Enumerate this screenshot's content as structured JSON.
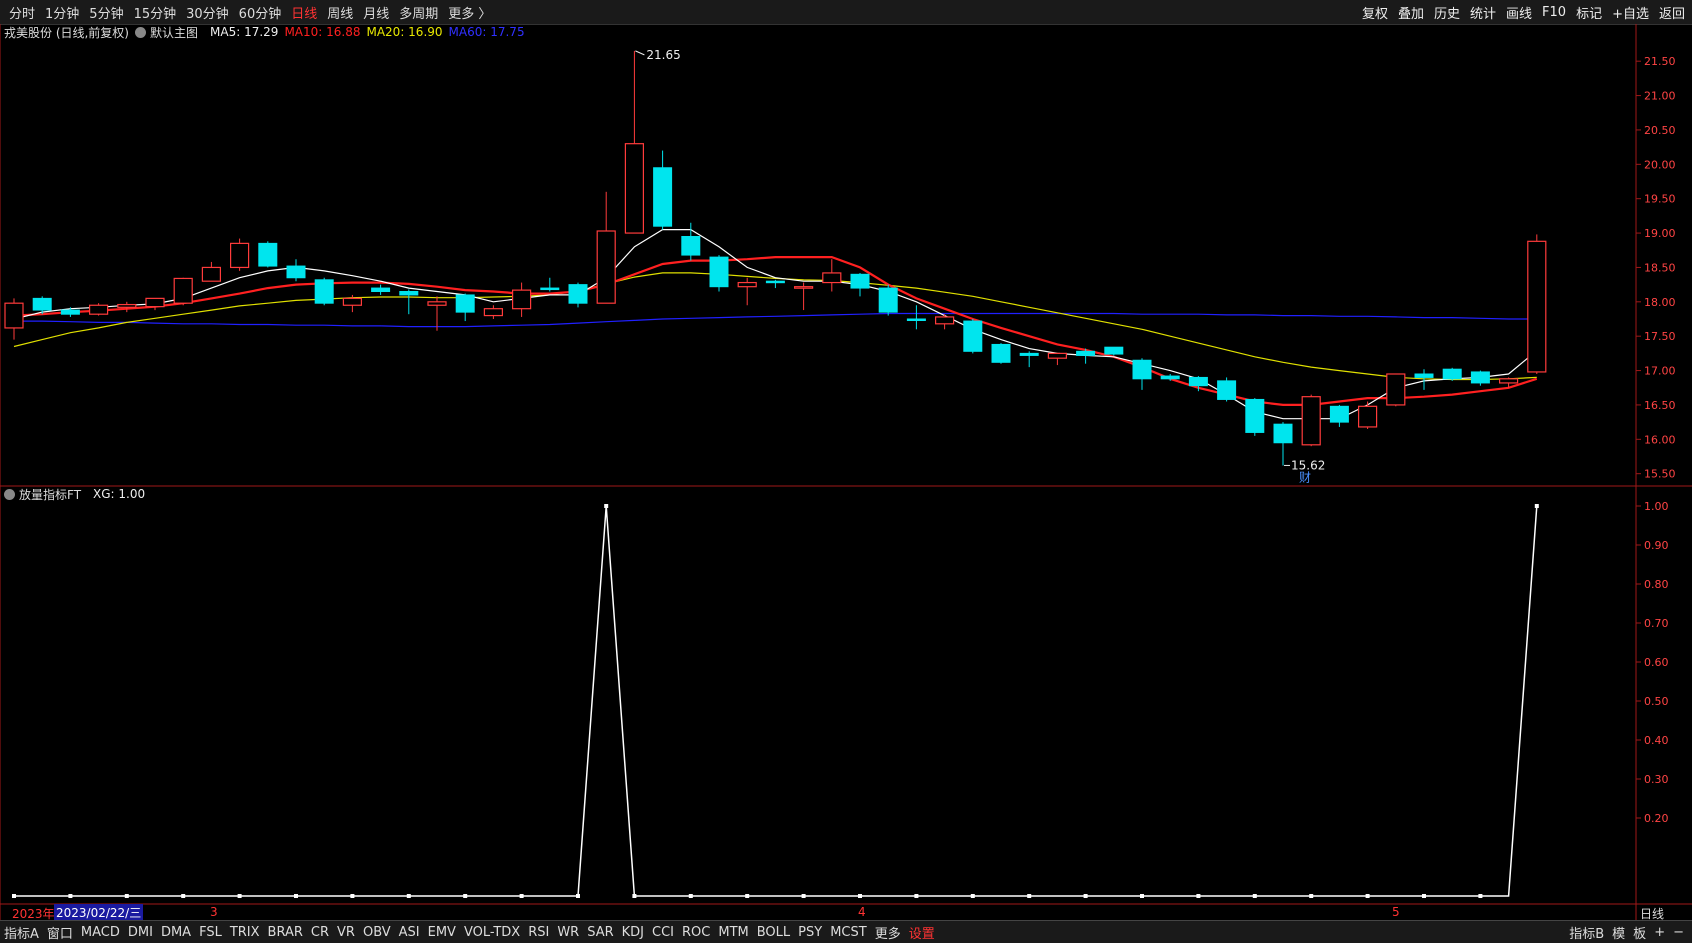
{
  "toolbar": {
    "periods": [
      "分时",
      "1分钟",
      "5分钟",
      "15分钟",
      "30分钟",
      "60分钟",
      "日线",
      "周线",
      "月线",
      "多周期",
      "更多 〉"
    ],
    "active_period": "日线",
    "right_buttons": [
      "复权",
      "叠加",
      "历史",
      "统计",
      "画线",
      "F10",
      "标记",
      "+自选",
      "返回"
    ]
  },
  "main_legend": {
    "stock": "戎美股份 (日线,前复权)",
    "template": "默认主图",
    "ma5": "MA5: 17.29",
    "ma10": "MA10: 16.88",
    "ma20": "MA20: 16.90",
    "ma60": "MA60: 17.75",
    "colors": {
      "ma5": "#ffffff",
      "ma10": "#ff2020",
      "ma20": "#e0e000",
      "ma60": "#2020ff",
      "up": "#ff3b3b",
      "down": "#00e5ee"
    }
  },
  "sub_legend": {
    "name": "放量指标FT",
    "value": "XG: 1.00"
  },
  "annotations": {
    "high": "21.65",
    "low": "15.62",
    "finance_mark": "财"
  },
  "price_axis": {
    "ticks": [
      "21.50",
      "21.00",
      "20.50",
      "20.00",
      "19.50",
      "19.00",
      "18.50",
      "18.00",
      "17.50",
      "17.00",
      "16.50",
      "16.00",
      "15.50"
    ],
    "min": 15.35,
    "max": 21.75
  },
  "indicator_axis": {
    "ticks": [
      "1.00",
      "0.90",
      "0.80",
      "0.70",
      "0.60",
      "0.50",
      "0.40",
      "0.30",
      "0.20"
    ]
  },
  "time_axis": {
    "year": "2023年",
    "cursor_date": "2023/02/22/三",
    "month_marks": [
      "3",
      "4",
      "5"
    ],
    "period": "日线"
  },
  "chart_data": {
    "type": "candlestick",
    "candles": [
      {
        "o": 17.62,
        "h": 18.05,
        "l": 17.45,
        "c": 17.98
      },
      {
        "o": 18.05,
        "h": 18.08,
        "l": 17.82,
        "c": 17.88
      },
      {
        "o": 17.88,
        "h": 17.92,
        "l": 17.78,
        "c": 17.82
      },
      {
        "o": 17.82,
        "h": 17.98,
        "l": 17.8,
        "c": 17.95
      },
      {
        "o": 17.92,
        "h": 18.0,
        "l": 17.85,
        "c": 17.96
      },
      {
        "o": 17.93,
        "h": 18.05,
        "l": 17.88,
        "c": 18.05
      },
      {
        "o": 17.98,
        "h": 18.35,
        "l": 17.95,
        "c": 18.34
      },
      {
        "o": 18.3,
        "h": 18.58,
        "l": 18.3,
        "c": 18.5
      },
      {
        "o": 18.5,
        "h": 18.92,
        "l": 18.45,
        "c": 18.85
      },
      {
        "o": 18.85,
        "h": 18.88,
        "l": 18.5,
        "c": 18.52
      },
      {
        "o": 18.52,
        "h": 18.62,
        "l": 18.3,
        "c": 18.35
      },
      {
        "o": 18.32,
        "h": 18.35,
        "l": 17.95,
        "c": 17.98
      },
      {
        "o": 17.95,
        "h": 18.1,
        "l": 17.85,
        "c": 18.05
      },
      {
        "o": 18.2,
        "h": 18.25,
        "l": 18.1,
        "c": 18.15
      },
      {
        "o": 18.15,
        "h": 18.18,
        "l": 17.82,
        "c": 18.1
      },
      {
        "o": 17.95,
        "h": 18.08,
        "l": 17.58,
        "c": 18.0
      },
      {
        "o": 18.1,
        "h": 18.12,
        "l": 17.72,
        "c": 17.85
      },
      {
        "o": 17.8,
        "h": 17.95,
        "l": 17.75,
        "c": 17.9
      },
      {
        "o": 17.9,
        "h": 18.28,
        "l": 17.78,
        "c": 18.17
      },
      {
        "o": 18.2,
        "h": 18.35,
        "l": 18.15,
        "c": 18.18
      },
      {
        "o": 18.25,
        "h": 18.28,
        "l": 17.92,
        "c": 17.98
      },
      {
        "o": 17.98,
        "h": 19.6,
        "l": 17.98,
        "c": 19.03
      },
      {
        "o": 19.0,
        "h": 21.65,
        "l": 19.0,
        "c": 20.3
      },
      {
        "o": 19.95,
        "h": 20.2,
        "l": 19.05,
        "c": 19.1
      },
      {
        "o": 18.95,
        "h": 19.15,
        "l": 18.6,
        "c": 18.68
      },
      {
        "o": 18.65,
        "h": 18.68,
        "l": 18.15,
        "c": 18.22
      },
      {
        "o": 18.22,
        "h": 18.35,
        "l": 17.95,
        "c": 18.28
      },
      {
        "o": 18.3,
        "h": 18.32,
        "l": 18.2,
        "c": 18.28
      },
      {
        "o": 18.2,
        "h": 18.28,
        "l": 17.88,
        "c": 18.22
      },
      {
        "o": 18.28,
        "h": 18.62,
        "l": 18.15,
        "c": 18.42
      },
      {
        "o": 18.4,
        "h": 18.42,
        "l": 18.08,
        "c": 18.2
      },
      {
        "o": 18.2,
        "h": 18.25,
        "l": 17.8,
        "c": 17.85
      },
      {
        "o": 17.75,
        "h": 17.95,
        "l": 17.6,
        "c": 17.73
      },
      {
        "o": 17.68,
        "h": 17.82,
        "l": 17.6,
        "c": 17.78
      },
      {
        "o": 17.72,
        "h": 17.75,
        "l": 17.25,
        "c": 17.28
      },
      {
        "o": 17.38,
        "h": 17.4,
        "l": 17.1,
        "c": 17.12
      },
      {
        "o": 17.25,
        "h": 17.28,
        "l": 17.05,
        "c": 17.22
      },
      {
        "o": 17.18,
        "h": 17.25,
        "l": 17.08,
        "c": 17.25
      },
      {
        "o": 17.28,
        "h": 17.32,
        "l": 17.1,
        "c": 17.22
      },
      {
        "o": 17.34,
        "h": 17.34,
        "l": 17.22,
        "c": 17.24
      },
      {
        "o": 17.15,
        "h": 17.18,
        "l": 16.72,
        "c": 16.88
      },
      {
        "o": 16.92,
        "h": 16.95,
        "l": 16.85,
        "c": 16.88
      },
      {
        "o": 16.9,
        "h": 16.92,
        "l": 16.7,
        "c": 16.78
      },
      {
        "o": 16.85,
        "h": 16.9,
        "l": 16.55,
        "c": 16.58
      },
      {
        "o": 16.58,
        "h": 16.6,
        "l": 16.05,
        "c": 16.1
      },
      {
        "o": 16.22,
        "h": 16.25,
        "l": 15.62,
        "c": 15.95
      },
      {
        "o": 15.92,
        "h": 16.65,
        "l": 15.9,
        "c": 16.62
      },
      {
        "o": 16.48,
        "h": 16.5,
        "l": 16.18,
        "c": 16.25
      },
      {
        "o": 16.18,
        "h": 16.55,
        "l": 16.15,
        "c": 16.48
      },
      {
        "o": 16.5,
        "h": 16.95,
        "l": 16.48,
        "c": 16.95
      },
      {
        "o": 16.95,
        "h": 17.02,
        "l": 16.72,
        "c": 16.9
      },
      {
        "o": 17.02,
        "h": 17.04,
        "l": 16.85,
        "c": 16.88
      },
      {
        "o": 16.98,
        "h": 17.0,
        "l": 16.78,
        "c": 16.82
      },
      {
        "o": 16.82,
        "h": 16.9,
        "l": 16.75,
        "c": 16.88
      },
      {
        "o": 16.98,
        "h": 18.98,
        "l": 16.95,
        "c": 18.88
      }
    ],
    "ma5": [
      17.75,
      17.85,
      17.9,
      17.92,
      17.95,
      17.97,
      18.05,
      18.2,
      18.35,
      18.45,
      18.5,
      18.45,
      18.38,
      18.3,
      18.2,
      18.15,
      18.1,
      18.0,
      18.05,
      18.1,
      18.1,
      18.35,
      18.8,
      19.05,
      19.05,
      18.8,
      18.5,
      18.35,
      18.3,
      18.3,
      18.25,
      18.15,
      18.0,
      17.8,
      17.6,
      17.45,
      17.32,
      17.25,
      17.22,
      17.2,
      17.1,
      17.0,
      16.88,
      16.65,
      16.4,
      16.3,
      16.3,
      16.3,
      16.5,
      16.75,
      16.85,
      16.88,
      16.9,
      16.95,
      17.29
    ],
    "ma10": [
      17.8,
      17.82,
      17.85,
      17.87,
      17.9,
      17.93,
      17.98,
      18.05,
      18.12,
      18.2,
      18.25,
      18.27,
      18.28,
      18.28,
      18.26,
      18.22,
      18.17,
      18.15,
      18.12,
      18.12,
      18.15,
      18.25,
      18.4,
      18.55,
      18.6,
      18.6,
      18.62,
      18.65,
      18.65,
      18.65,
      18.5,
      18.25,
      18.05,
      17.9,
      17.75,
      17.62,
      17.5,
      17.38,
      17.3,
      17.2,
      17.05,
      16.88,
      16.75,
      16.65,
      16.55,
      16.5,
      16.5,
      16.55,
      16.6,
      16.6,
      16.62,
      16.65,
      16.7,
      16.75,
      16.88
    ],
    "ma20": [
      17.35,
      17.45,
      17.55,
      17.62,
      17.7,
      17.76,
      17.82,
      17.88,
      17.94,
      17.98,
      18.02,
      18.04,
      18.06,
      18.07,
      18.07,
      18.06,
      18.06,
      18.07,
      18.08,
      18.1,
      18.16,
      18.26,
      18.36,
      18.42,
      18.42,
      18.4,
      18.37,
      18.34,
      18.32,
      18.31,
      18.28,
      18.24,
      18.2,
      18.14,
      18.08,
      18.0,
      17.92,
      17.84,
      17.76,
      17.68,
      17.6,
      17.5,
      17.4,
      17.3,
      17.2,
      17.12,
      17.05,
      17.0,
      16.95,
      16.9,
      16.88,
      16.87,
      16.87,
      16.88,
      16.9
    ],
    "ma60": [
      17.72,
      17.72,
      17.71,
      17.7,
      17.7,
      17.69,
      17.68,
      17.68,
      17.67,
      17.67,
      17.66,
      17.66,
      17.65,
      17.65,
      17.64,
      17.64,
      17.64,
      17.65,
      17.66,
      17.67,
      17.69,
      17.71,
      17.73,
      17.75,
      17.76,
      17.77,
      17.78,
      17.79,
      17.8,
      17.81,
      17.82,
      17.83,
      17.83,
      17.83,
      17.83,
      17.83,
      17.83,
      17.83,
      17.83,
      17.83,
      17.82,
      17.82,
      17.82,
      17.81,
      17.81,
      17.8,
      17.8,
      17.79,
      17.79,
      17.78,
      17.77,
      17.77,
      17.76,
      17.75,
      17.75
    ],
    "xg": [
      0,
      0,
      0,
      0,
      0,
      0,
      0,
      0,
      0,
      0,
      0,
      0,
      0,
      0,
      0,
      0,
      0,
      0,
      0,
      0,
      0,
      1,
      0,
      0,
      0,
      0,
      0,
      0,
      0,
      0,
      0,
      0,
      0,
      0,
      0,
      0,
      0,
      0,
      0,
      0,
      0,
      0,
      0,
      0,
      0,
      0,
      0,
      0,
      0,
      0,
      0,
      0,
      0,
      0,
      1
    ],
    "y_range_price": [
      15.35,
      21.75
    ],
    "y_range_indicator": [
      0,
      1
    ]
  },
  "bottom_tabs": [
    "指标A",
    "窗口",
    "MACD",
    "DMI",
    "DMA",
    "FSL",
    "TRIX",
    "BRAR",
    "CR",
    "VR",
    "OBV",
    "ASI",
    "EMV",
    "VOL-TDX",
    "RSI",
    "WR",
    "SAR",
    "KDJ",
    "CCI",
    "ROC",
    "MTM",
    "BOLL",
    "PSY",
    "MCST",
    "更多",
    "设置"
  ],
  "bottom_right": [
    "指标B",
    "模",
    "板",
    "+",
    "−"
  ]
}
